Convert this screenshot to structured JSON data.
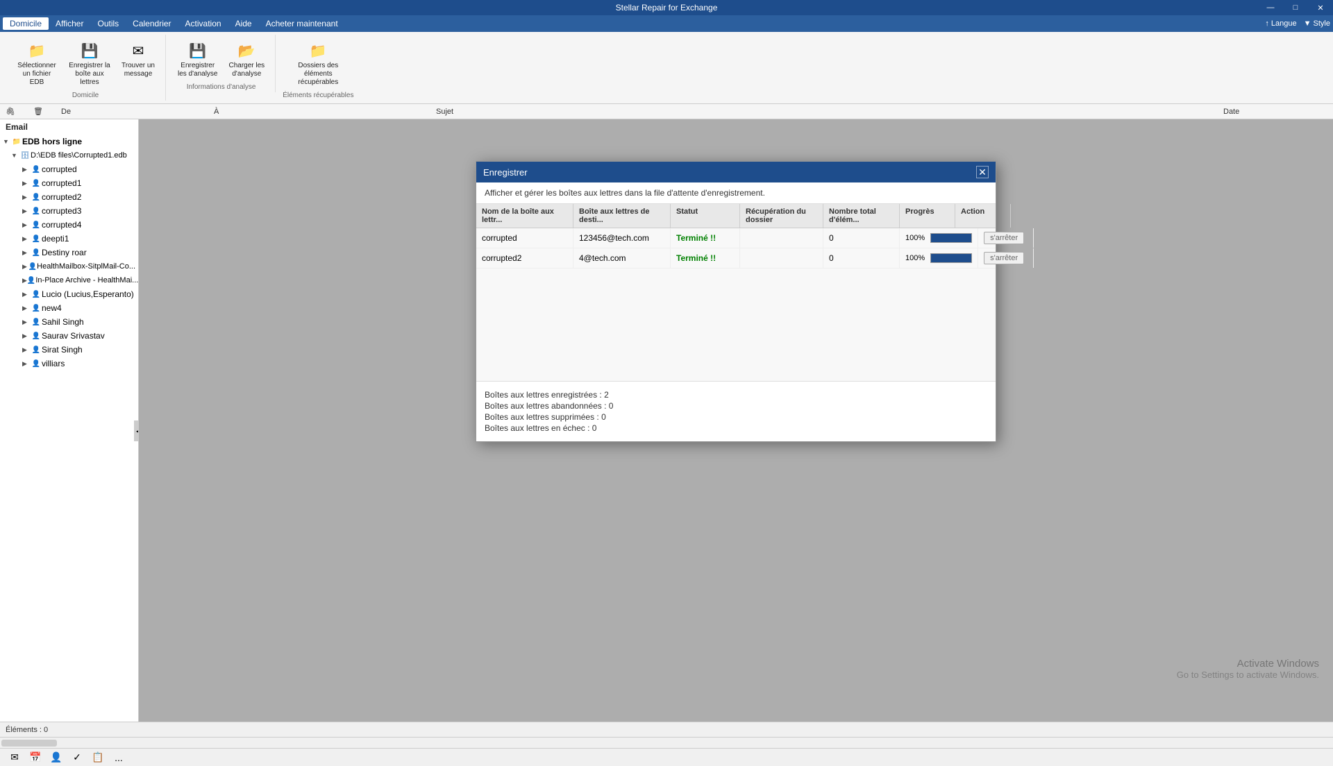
{
  "window": {
    "title": "Stellar Repair for Exchange",
    "minimize": "—",
    "maximize": "□",
    "close": "✕"
  },
  "menu": {
    "items": [
      "Domicile",
      "Afficher",
      "Outils",
      "Calendrier",
      "Activation",
      "Aide",
      "Acheter maintenant"
    ],
    "active": "Domicile"
  },
  "ribbon": {
    "groups": [
      {
        "label": "Domicile",
        "buttons": [
          {
            "icon": "📁",
            "label": "Sélectionner\nun fichier EDB"
          },
          {
            "icon": "💾",
            "label": "Enregistrer la\nboîte aux lettres"
          },
          {
            "icon": "✉",
            "label": "Trouver un\nmessage"
          }
        ]
      },
      {
        "label": "Informations d'analyse",
        "buttons": [
          {
            "icon": "💾",
            "label": "Enregistrer\nles d'analyse"
          },
          {
            "icon": "📂",
            "label": "Charger les\nd'analyse"
          }
        ]
      },
      {
        "label": "Éléments récupérables",
        "buttons": [
          {
            "icon": "📁",
            "label": "Dossiers des éléments\nrécupérables"
          }
        ]
      }
    ]
  },
  "top_right_labels": {
    "langue": "↑ Langue",
    "style": "▼ Style"
  },
  "columns": {
    "attach": "🖇",
    "del": "🗑",
    "de": "De",
    "a": "À",
    "sujet": "Sujet",
    "date": "Date"
  },
  "sidebar": {
    "header": "Email",
    "root": "EDB hors ligne",
    "db_path": "D:\\EDB files\\Corrupted1.edb",
    "items": [
      {
        "label": "corrupted",
        "level": 3
      },
      {
        "label": "corrupted1",
        "level": 3
      },
      {
        "label": "corrupted2",
        "level": 3
      },
      {
        "label": "corrupted3",
        "level": 3
      },
      {
        "label": "corrupted4",
        "level": 3
      },
      {
        "label": "deepti1",
        "level": 3
      },
      {
        "label": "Destiny roar",
        "level": 3
      },
      {
        "label": "HealthMailbox-SitplMail-Co...",
        "level": 3
      },
      {
        "label": "In-Place Archive - HealthMai...",
        "level": 3
      },
      {
        "label": "Lucio (Lucius,Esperanto)",
        "level": 3
      },
      {
        "label": "new4",
        "level": 3
      },
      {
        "label": "Sahil Singh",
        "level": 3
      },
      {
        "label": "Saurav Srivastav",
        "level": 3
      },
      {
        "label": "Sirat Singh",
        "level": 3
      },
      {
        "label": "villiars",
        "level": 3
      }
    ]
  },
  "modal": {
    "title": "Enregistrer",
    "description": "Afficher et gérer les boîtes aux lettres dans la file d'attente d'enregistrement.",
    "close_btn": "✕",
    "table": {
      "headers": [
        "Nom de la boîte aux lettr...",
        "Boîte aux lettres de desti...",
        "Statut",
        "Récupération du dossier",
        "Nombre total d'élém...",
        "Progrès",
        "Action"
      ],
      "rows": [
        {
          "name": "corrupted",
          "dest": "123456@tech.com",
          "status": "Terminé !!",
          "folder_recovery": "",
          "total_elements": "0",
          "progress": 100,
          "action": "s'arrêter"
        },
        {
          "name": "corrupted2",
          "dest": "4@tech.com",
          "status": "Terminé !!",
          "folder_recovery": "",
          "total_elements": "0",
          "progress": 100,
          "action": "s'arrêter"
        }
      ]
    },
    "footer": {
      "line1": "Boîtes aux lettres enregistrées : 2",
      "line2": "Boîtes aux lettres abandonnées : 0",
      "line3": "Boîtes aux lettres supprimées : 0",
      "line4": "Boîtes aux lettres en échec : 0"
    }
  },
  "status_bar": {
    "elements": "Éléments : 0"
  },
  "bottom_nav": {
    "icons": [
      "✉",
      "📅",
      "👤",
      "✓",
      "📋",
      "..."
    ]
  },
  "activate_windows": {
    "line1": "Activate Windows",
    "line2": "Go to Settings to activate Windows."
  }
}
